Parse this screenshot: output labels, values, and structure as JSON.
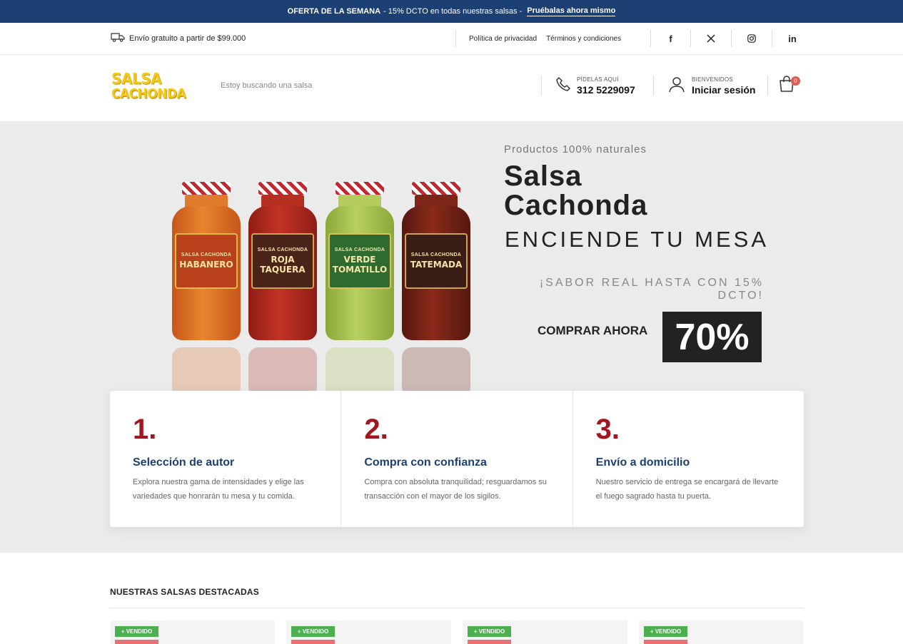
{
  "promo": {
    "headline": "OFERTA DE LA SEMANA",
    "text": "- 15% DCTO en todas nuestras salsas -",
    "link": "Pruébalas ahora mismo"
  },
  "utility": {
    "shipping": "Envío gratuito a partir de $99.000",
    "privacy": "Política de privacidad",
    "terms": "Términos y condiciones",
    "social": [
      "facebook-icon",
      "x-icon",
      "instagram-icon",
      "linkedin-icon"
    ]
  },
  "header": {
    "logo_line1": "SALSA",
    "logo_line2": "CACHONDA",
    "search_placeholder": "Estoy buscando una salsa",
    "phone_label": "PÍDELAS AQUÍ",
    "phone_number": "312 5229097",
    "welcome": "BIENVENIDOS",
    "login": "Iniciar sesión",
    "cart_count": "0"
  },
  "hero": {
    "eyebrow": "Productos 100% naturales",
    "title_line1": "Salsa",
    "title_line2": "Cachonda",
    "subtitle": "ENCIENDE TU MESA",
    "note": "¡SABOR REAL HASTA CON 15% DCTO!",
    "cta": "COMPRAR AHORA",
    "discount": "70%",
    "bottles": [
      {
        "brand": "SALSA CACHONDA",
        "name": "HABANERO",
        "color": "#d8651c",
        "label": "#b8401a"
      },
      {
        "brand": "SALSA CACHONDA",
        "name": "ROJA TAQUERA",
        "color": "#a8241a",
        "label": "#4a2418"
      },
      {
        "brand": "SALSA CACHONDA",
        "name": "VERDE TOMATILLO",
        "color": "#a5c04a",
        "label": "#2f6b2f"
      },
      {
        "brand": "SALSA CACHONDA",
        "name": "TATEMADA",
        "color": "#6e1f14",
        "label": "#3a1d14"
      }
    ]
  },
  "features": [
    {
      "num": "1.",
      "title": "Selección de autor",
      "desc": "Explora nuestra gama de intensidades y elige las variedades que honrarán tu mesa y tu comida."
    },
    {
      "num": "2.",
      "title": "Compra con confianza",
      "desc": "Compra con absoluta tranquilidad; resguardamos su transacción con el mayor de los sigilos."
    },
    {
      "num": "3.",
      "title": "Envío a domicilio",
      "desc": "Nuestro servicio de entrega se encargará de llevarte el fuego sagrado hasta tu puerta."
    }
  ],
  "featured": {
    "title": "NUESTRAS SALSAS DESTACADAS",
    "badge": "+ VENDIDO"
  }
}
